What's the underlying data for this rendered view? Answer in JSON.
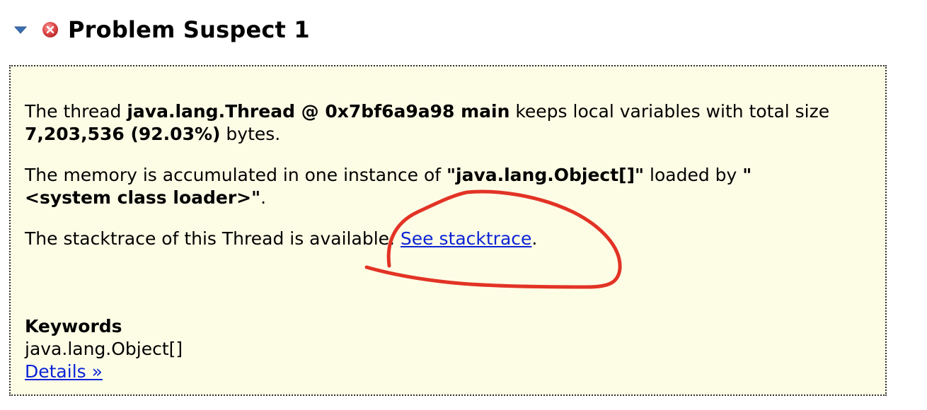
{
  "section": {
    "title": "Problem Suspect 1",
    "expand_icon": "chevron-down-icon",
    "status_icon": "error-icon",
    "colors": {
      "chevron": "#3b6fb3",
      "error": "#e04a4a",
      "panel_bg": "#fdfde6",
      "link": "#0b23d6",
      "annotation": "#e23325"
    }
  },
  "description": {
    "p1": {
      "t1": "The thread ",
      "b1": "java.lang.Thread @ 0x7bf6a9a98 main",
      "t2": " keeps local variables with total size",
      "b2": "7,203,536 (92.03%)",
      "t3": " bytes."
    },
    "p2": {
      "t1": "The memory is accumulated in one instance of ",
      "b1": "\"java.lang.Object[]\"",
      "t2": " loaded by ",
      "b2a": "\"",
      "b2b": "<system class loader>\"",
      "t3": "."
    },
    "p3": {
      "t1": "The stacktrace of this Thread is available. ",
      "link": "See stacktrace",
      "t2": "."
    }
  },
  "keywords": {
    "heading": "Keywords",
    "value": "java.lang.Object[]",
    "details_link": "Details »"
  }
}
